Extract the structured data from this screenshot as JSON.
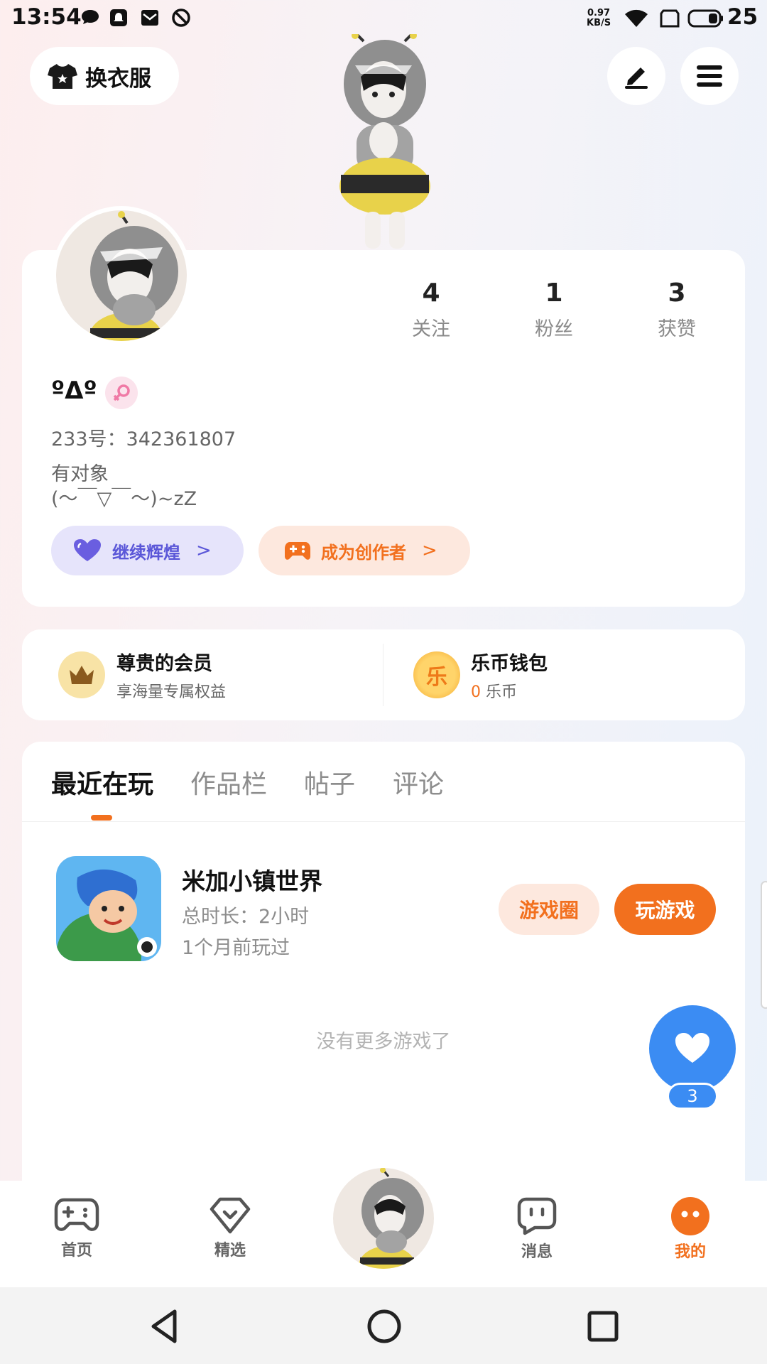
{
  "status_bar": {
    "time": "13:54",
    "net_speed_value": "0.97",
    "net_speed_unit": "KB/S",
    "battery": "25"
  },
  "top": {
    "dress_up_label": "换衣服"
  },
  "profile": {
    "nickname": "ºΔº",
    "uid_line": "233号：342361807",
    "bio_line1": "有对象",
    "bio_line2": "(〜￣▽￣〜)~zZ",
    "stats": [
      {
        "value": "4",
        "label": "关注"
      },
      {
        "value": "1",
        "label": "粉丝"
      },
      {
        "value": "3",
        "label": "获赞"
      }
    ],
    "shine_button": "继续辉煌",
    "creator_button": "成为创作者"
  },
  "membership": {
    "vip_title": "尊贵的会员",
    "vip_subtitle": "享海量专属权益",
    "wallet_title": "乐币钱包",
    "wallet_amount": "0",
    "wallet_unit": "乐币",
    "wallet_coin_char": "乐"
  },
  "tabs": [
    {
      "label": "最近在玩",
      "active": true
    },
    {
      "label": "作品栏",
      "active": false
    },
    {
      "label": "帖子",
      "active": false
    },
    {
      "label": "评论",
      "active": false
    }
  ],
  "recent_game": {
    "name": "米加小镇世界",
    "duration": "总时长：2小时",
    "last_played": "1个月前玩过",
    "circle_button": "游戏圈",
    "play_button": "玩游戏"
  },
  "no_more_text": "没有更多游戏了",
  "like_count": "3",
  "bottom_nav": [
    {
      "label": "首页",
      "icon": "gamepad-icon",
      "active": false
    },
    {
      "label": "精选",
      "icon": "heart-badge-icon",
      "active": false
    },
    {
      "label": "消息",
      "icon": "chat-icon",
      "active": false
    },
    {
      "label": "我的",
      "icon": "profile-dots-icon",
      "active": true
    }
  ],
  "colors": {
    "accent": "#f2701e",
    "like_blue": "#3b8cf3",
    "shine_purple": "#5b57d8"
  }
}
